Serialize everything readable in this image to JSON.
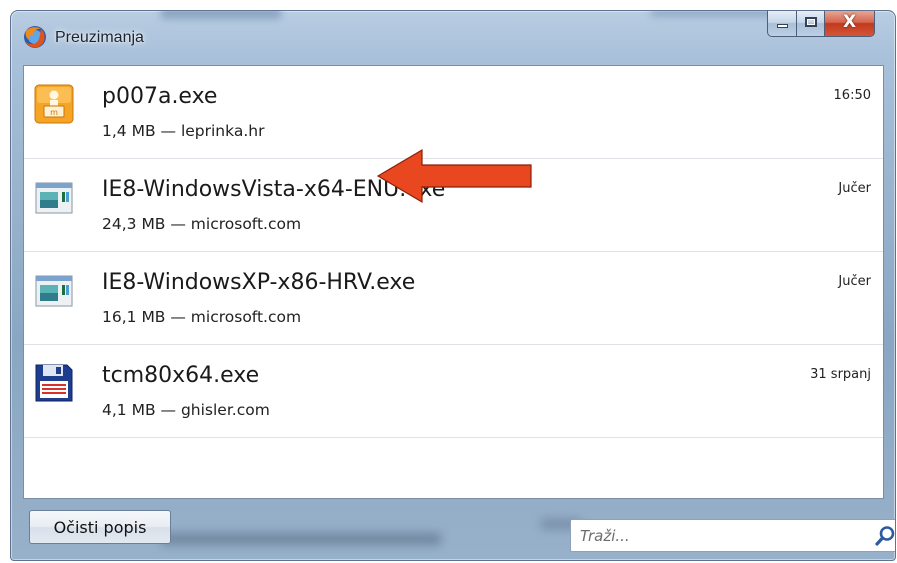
{
  "window": {
    "title": "Preuzimanja",
    "close_glyph": "X"
  },
  "downloads": [
    {
      "name": "p007a.exe",
      "meta": "1,4 MB — leprinka.hr",
      "time": "16:50",
      "icon": "installer-package-icon"
    },
    {
      "name": "IE8-WindowsVista-x64-ENU.exe",
      "meta": "24,3 MB — microsoft.com",
      "time": "Jučer",
      "icon": "application-window-icon"
    },
    {
      "name": "IE8-WindowsXP-x86-HRV.exe",
      "meta": "16,1 MB — microsoft.com",
      "time": "Jučer",
      "icon": "application-window-icon"
    },
    {
      "name": "tcm80x64.exe",
      "meta": "4,1 MB — ghisler.com",
      "time": "31 srpanj",
      "icon": "floppy-disk-icon"
    }
  ],
  "footer": {
    "clear_button": "Očisti popis",
    "search_placeholder": "Traži..."
  },
  "colors": {
    "arrow": "#e8471f",
    "frame": "#9bb5cf",
    "close_button": "#c23a1d"
  }
}
